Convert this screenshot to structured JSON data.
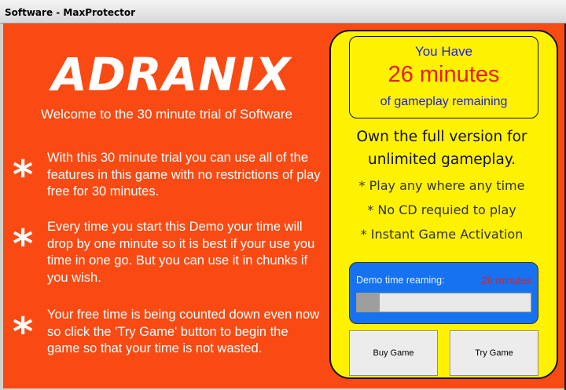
{
  "window": {
    "title": "Software - MaxProtector"
  },
  "logo": {
    "text": "ADRANIX"
  },
  "welcome": "Welcome to the 30 minute trial of Software",
  "bullets": [
    {
      "star": "*",
      "text": "With this 30 minute trial you can use all of the features in this game with no restrictions of play free for 30 minutes."
    },
    {
      "star": "*",
      "text": "Every time you start this Demo your time will drop by one minute so it is best if your use you time in one go. But you can use it in chunks if you wish."
    },
    {
      "star": "*",
      "text": "Your free time is being counted down even now so click the 'Try Game' button to begin the game so that your time is not wasted."
    }
  ],
  "time_box": {
    "line1": "You Have",
    "line2": "26 minutes",
    "line3": "of gameplay remaining"
  },
  "own": {
    "line1": "Own the full version for",
    "line2": "unlimited gameplay."
  },
  "features": [
    "* Play any where any time",
    "* No CD requied to play",
    "* Instant Game Activation"
  ],
  "demo": {
    "label": "Demo time reaming:",
    "value": "26 minutes",
    "progress_fraction": 0.13
  },
  "buttons": {
    "buy": "Buy Game",
    "try": "Try Game"
  },
  "colors": {
    "background": "#fa4a14",
    "panel": "#fff200",
    "demo_box": "#1672f0",
    "minutes_red": "#ee1a14",
    "blue_text": "#1e1ed8"
  }
}
